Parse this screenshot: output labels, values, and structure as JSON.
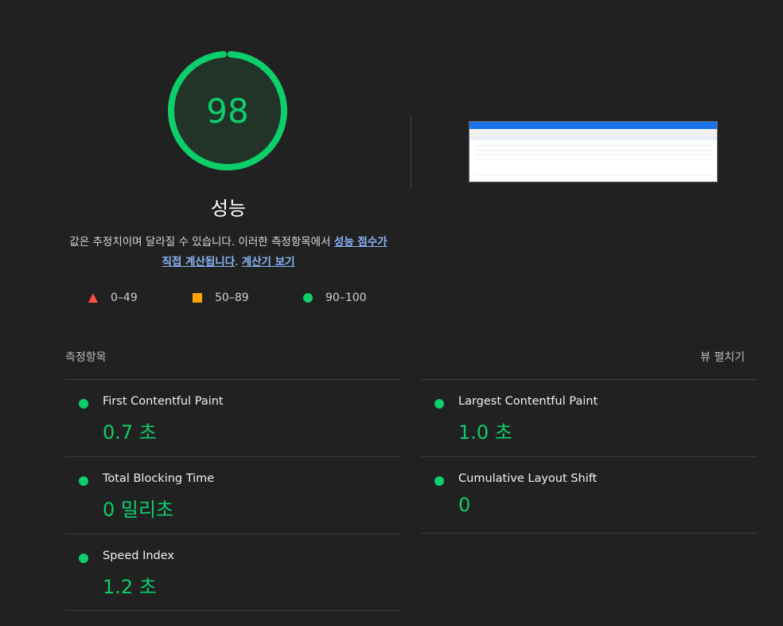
{
  "gauge": {
    "score": "98",
    "label": "성능",
    "value_percent": 98,
    "color": "#0cce6b"
  },
  "description": {
    "text_prefix": "값은 추정치이며 달라질 수 있습니다. 이러한 측정항목에서 ",
    "link1": "성능 점수가 직접 계산됩니다",
    "text_middle": ". ",
    "link2": "계산기 보기"
  },
  "legend": [
    {
      "range": "0–49",
      "shape": "triangle",
      "color": "#ff4e42"
    },
    {
      "range": "50–89",
      "shape": "square",
      "color": "#ffa400"
    },
    {
      "range": "90–100",
      "shape": "circle",
      "color": "#0cce6b"
    }
  ],
  "metrics_section": {
    "title": "측정항목",
    "expand_label": "뷰 펼치기",
    "items": [
      {
        "title": "First Contentful Paint",
        "value": "0.7 초"
      },
      {
        "title": "Largest Contentful Paint",
        "value": "1.0 초"
      },
      {
        "title": "Total Blocking Time",
        "value": "0 밀리초"
      },
      {
        "title": "Cumulative Layout Shift",
        "value": "0"
      },
      {
        "title": "Speed Index",
        "value": "1.2 초"
      }
    ]
  }
}
